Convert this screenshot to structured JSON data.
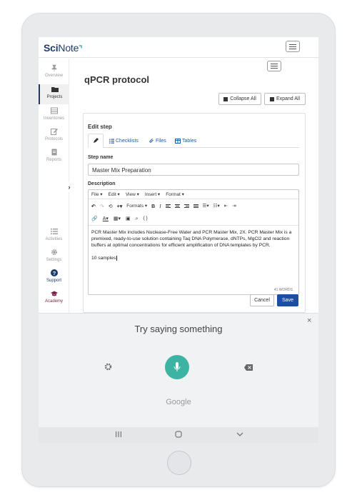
{
  "app": {
    "logo_sci": "Sci",
    "logo_note": "Note",
    "logo_tick": "⌝"
  },
  "sidebar": {
    "items": [
      {
        "label": "Overview",
        "icon": "pin-icon"
      },
      {
        "label": "Projects",
        "icon": "folder-icon"
      },
      {
        "label": "Inventories",
        "icon": "inventory-icon"
      },
      {
        "label": "Protocols",
        "icon": "edit-icon"
      },
      {
        "label": "Reports",
        "icon": "report-icon"
      },
      {
        "label": "Activities",
        "icon": "list-icon"
      },
      {
        "label": "Settings",
        "icon": "gear-icon"
      },
      {
        "label": "Support",
        "icon": "help-icon"
      },
      {
        "label": "Academy",
        "icon": "graduation-cap-icon"
      }
    ],
    "collapse_glyph": "›"
  },
  "main": {
    "title": "qPCR protocol",
    "collapse_all": "Collapse All",
    "expand_all": "Expand All"
  },
  "edit_step": {
    "title": "Edit step",
    "tabs": [
      {
        "label": "",
        "icon": "pencil-icon"
      },
      {
        "label": "Checklists",
        "icon": "checklist-icon"
      },
      {
        "label": "Files",
        "icon": "paperclip-icon"
      },
      {
        "label": "Tables",
        "icon": "table-icon"
      }
    ],
    "step_name_label": "Step name",
    "step_name_value": "Master Mix Preparation",
    "description_label": "Description",
    "menubar": [
      "File ▾",
      "Edit ▾",
      "View ▾",
      "Insert ▾",
      "Format ▾"
    ],
    "formats_label": "Formats ▾",
    "curly_label": "{ }",
    "body_paragraph": "PCR Master Mix includes Nuclease-Free Water and PCR Master Mix, 2X. PCR Master Mix is a premixed, ready-to-use solution containing Taq DNA Polymerase, dNTPs, MgCl2 and reaction buffers at optimal concentrations for efficient amplification of DNA templates by PCR.",
    "body_line2": "10 samples",
    "word_count": "41 WORDS",
    "cancel": "Cancel",
    "save": "Save"
  },
  "voice": {
    "prompt": "Try saying something",
    "brand": "Google",
    "close": "×"
  },
  "colors": {
    "brand": "#1b3c6b",
    "save": "#1b4fa0",
    "mic": "#3cb3a3",
    "link": "#1b5cab",
    "academy": "#7b1f4e"
  }
}
